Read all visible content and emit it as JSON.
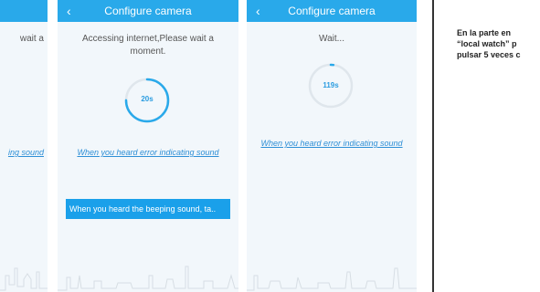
{
  "screens": [
    {
      "title": "",
      "message": "wait a",
      "link": "ing sound"
    },
    {
      "back_icon": "‹",
      "title": "Configure camera",
      "message": "Accessing internet,Please wait a moment.",
      "progress_value": "20s",
      "progress_fraction": 0.75,
      "link": "When you heard error indicating sound",
      "button": "When you heard the beeping sound, ta.."
    },
    {
      "back_icon": "‹",
      "title": "Configure camera",
      "message": "Wait...",
      "progress_value": "119s",
      "progress_fraction": 0.02,
      "link": "When you heard error indicating sound"
    }
  ],
  "note": {
    "line1": "En  la parte en",
    "line2_quote": "“",
    "line2_bold": "local watch",
    "line2_rest": "”  p",
    "line3": "pulsar 5 veces c"
  },
  "colors": {
    "accent": "#29a9ea",
    "link": "#2e8fd6",
    "ring_track": "#dfe6ec",
    "background": "#f2f7fb"
  }
}
